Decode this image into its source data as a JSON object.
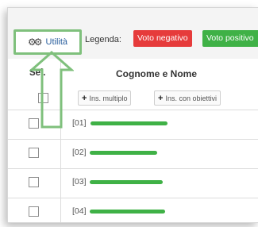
{
  "toolbar": {
    "utility_button": "Utilità",
    "legend_label": "Legenda:",
    "badges": {
      "negative": "Voto negativo",
      "positive": "Voto positivo"
    }
  },
  "table": {
    "columns": {
      "select": "Sel.",
      "name": "Cognome e Nome"
    },
    "buttons": {
      "multiple": "Ins. multiplo",
      "with_objectives": "Ins. con obiettivi"
    },
    "rows": [
      {
        "code": "[01]"
      },
      {
        "code": "[02]"
      },
      {
        "code": "[03]"
      },
      {
        "code": "[04]"
      }
    ]
  },
  "colors": {
    "accent_green": "#3fb146",
    "badge_negative": "#e63b3b",
    "badge_positive": "#3fb146",
    "annotation": "#7fc07c"
  },
  "icons": {
    "utility": "gears-icon",
    "add": "plus-icon"
  }
}
